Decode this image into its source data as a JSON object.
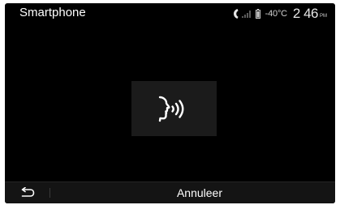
{
  "header": {
    "title": "Smartphone"
  },
  "status": {
    "phone_icon": "phone-handset-icon",
    "signal_icon": "signal-strength-icon",
    "battery_icon": "phone-battery-icon",
    "temperature": "-40°C",
    "time": "2 46",
    "ampm": "PM"
  },
  "main": {
    "voice_icon": "voice-recognition-icon"
  },
  "footer": {
    "back_icon": "back-arrow-icon",
    "cancel_label": "Annuleer"
  },
  "colors": {
    "background": "#000000",
    "text": "#ffffff",
    "panel": "#1b1b1b",
    "bottom_bar": "#141414"
  }
}
